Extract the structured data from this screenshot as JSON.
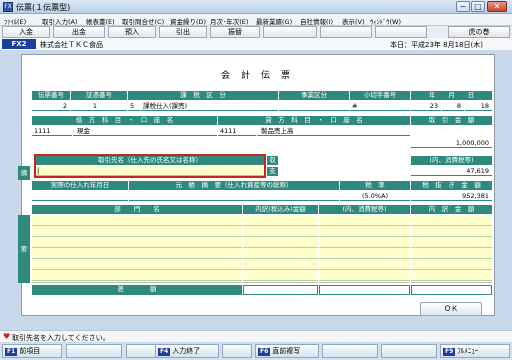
{
  "window": {
    "title": "伝票(１伝票型)",
    "app_icon": "FX",
    "min": "−",
    "max": "□",
    "close": "✕"
  },
  "menu": [
    "ﾌｧｲﾙ(E)",
    "取引入力(A)",
    "帳表書(E)",
    "取引問合せ(C)",
    "資金繰り(D)",
    "月次･年次(E)",
    "最新業績(G)",
    "自社情報(I)",
    "表示(V)",
    "ｳｨﾝﾄﾞｳ(W)"
  ],
  "buttons": {
    "nyukin": "入金",
    "shukkin": "出金",
    "azukari": "預入",
    "hikidashi": "引出",
    "furikae": "振替",
    "tora": "虎の巻"
  },
  "company": {
    "badge": "FX2",
    "name": "株式会社ＴＫＣ食品",
    "date": "本日：平成23年 8月18日(木)"
  },
  "voucher": {
    "title": "会　計　伝　票",
    "h1": {
      "denpyo": "伝票番号",
      "shoko": "証憑番号",
      "kazei": "課　税　区　分",
      "jigyo": "事業区分",
      "kogitte": "小切手番号",
      "date": "年　　月　　日"
    },
    "v1": {
      "denpyo": "2",
      "shoko": "1",
      "kazei_code": "5",
      "kazei": "課税仕入(課売)",
      "kogitte": "#",
      "year": "23",
      "month": "8",
      "day": "18"
    },
    "h2": {
      "debit": "借　方　科　目　・　口　座　名",
      "credit": "貸　方　科　目　・　口　座　名",
      "amount": "取　引　金　額"
    },
    "v2": {
      "debit_code": "1111",
      "debit_name": "現金",
      "credit_code": "4111",
      "credit_name": "製品売上高",
      "amount": "1,000,000"
    },
    "h3": {
      "partner": "取引先名（仕入先の氏名又は名称）",
      "shu": "収",
      "sho": "摘",
      "shi": "支",
      "tax_in": "(内、消費税等)"
    },
    "v3": {
      "partner": "|",
      "tax": "47,619"
    },
    "h4": {
      "date": "実際の仕入れ年月日",
      "tekiyo": "元　帳　摘　要（仕入れ資産等の総称）",
      "rate": "税　率",
      "net": "税　抜　き　金　額"
    },
    "v4": {
      "rate": "(5.0%A)",
      "net": "952,381"
    },
    "h5": {
      "dept": "部　　門　　名",
      "uchi_tax": "内訳(税込み)金額",
      "uchi_sho": "(内、消費税等)",
      "uchi": "内　訳　金　額"
    },
    "side_yo": "要",
    "footer_label": "差　　　　額",
    "ok": "ＯＫ"
  },
  "status": "取引先名を入力してください。",
  "keys": {
    "f1": {
      "k": "F1",
      "l": "前項目"
    },
    "f4": {
      "k": "F4",
      "l": "入力終了"
    },
    "f6": {
      "k": "F6",
      "l": "直前複写"
    },
    "f9": {
      "k": "F9",
      "l": "ﾌﾙﾒﾆｭｰ"
    }
  }
}
